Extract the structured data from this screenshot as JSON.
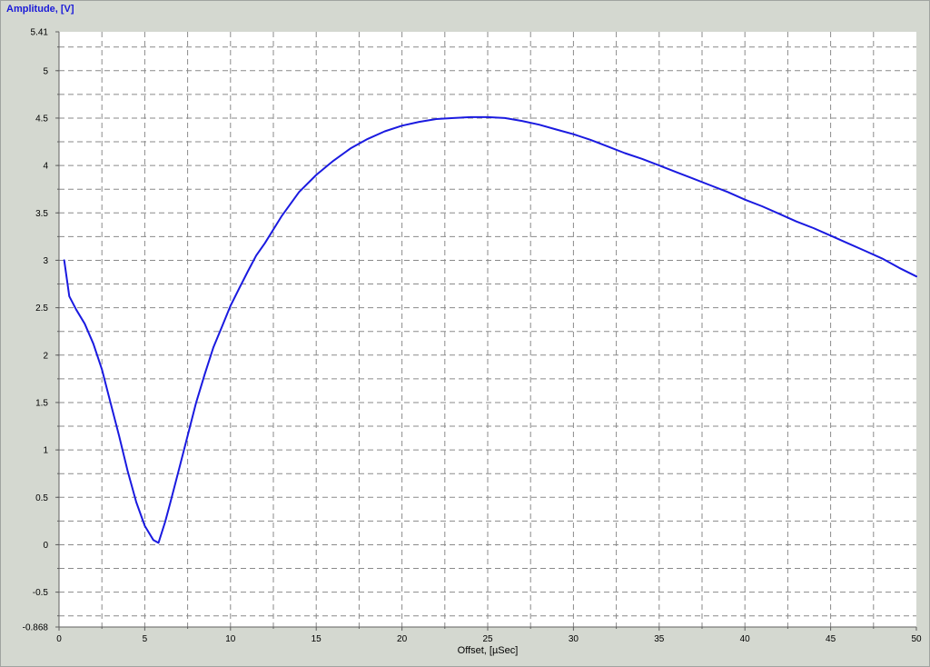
{
  "chart_data": {
    "type": "line",
    "title": "Amplitude, [V]",
    "xlabel": "Offset, [µSec]",
    "ylabel": "",
    "xlim": [
      0,
      50
    ],
    "ylim": [
      -0.868,
      5.41
    ],
    "grid": true,
    "x_ticks": [
      0,
      5,
      10,
      15,
      20,
      25,
      30,
      35,
      40,
      45,
      50
    ],
    "x_tick_labels": [
      "0",
      "5",
      "10",
      "15",
      "20",
      "25",
      "30",
      "35",
      "40",
      "45",
      "50"
    ],
    "y_ticks": [
      -0.868,
      -0.5,
      0,
      0.5,
      1,
      1.5,
      2,
      2.5,
      3,
      3.5,
      4,
      4.5,
      5,
      5.41
    ],
    "y_tick_labels": [
      "-0.868",
      "-0.5",
      "0",
      "0.5",
      "1",
      "1.5",
      "2",
      "2.5",
      "3",
      "3.5",
      "4",
      "4.5",
      "5",
      "5.41"
    ],
    "series": [
      {
        "color": "#1a1ae0",
        "x": [
          0.3,
          0.6,
          1,
          1.5,
          2,
          2.5,
          3,
          3.5,
          4,
          4.5,
          5,
          5.5,
          5.8,
          6.2,
          6.5,
          7,
          7.5,
          8,
          8.5,
          9,
          9.5,
          10,
          10.5,
          11,
          11.5,
          12,
          13,
          14,
          15,
          16,
          17,
          18,
          19,
          20,
          21,
          22,
          23,
          24,
          25,
          26,
          27,
          28,
          29,
          30,
          31,
          32,
          33,
          34,
          35,
          36,
          37,
          38,
          39,
          40,
          41,
          42,
          43,
          44,
          45,
          46,
          47,
          48,
          49,
          50
        ],
        "y": [
          3.0,
          2.62,
          2.48,
          2.33,
          2.12,
          1.85,
          1.5,
          1.15,
          0.78,
          0.45,
          0.2,
          0.05,
          0.02,
          0.25,
          0.45,
          0.8,
          1.15,
          1.5,
          1.8,
          2.08,
          2.3,
          2.52,
          2.7,
          2.88,
          3.05,
          3.18,
          3.47,
          3.72,
          3.9,
          4.05,
          4.18,
          4.28,
          4.36,
          4.42,
          4.46,
          4.49,
          4.5,
          4.51,
          4.51,
          4.5,
          4.47,
          4.43,
          4.38,
          4.33,
          4.27,
          4.2,
          4.13,
          4.07,
          4.0,
          3.93,
          3.86,
          3.79,
          3.72,
          3.64,
          3.57,
          3.49,
          3.41,
          3.34,
          3.26,
          3.18,
          3.1,
          3.02,
          2.92,
          2.83
        ]
      }
    ]
  }
}
